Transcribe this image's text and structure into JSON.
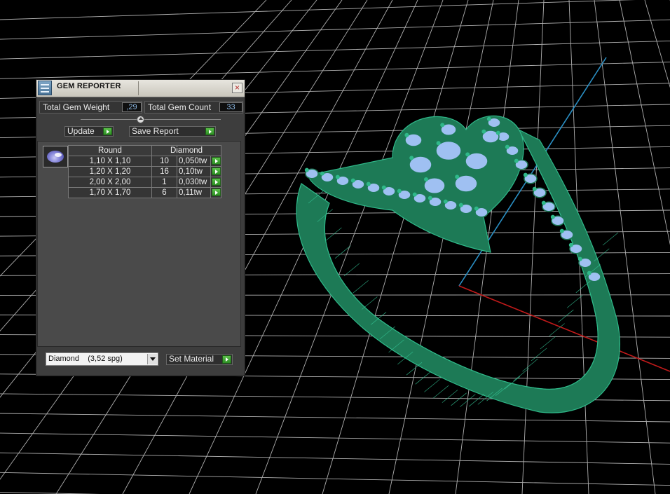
{
  "window": {
    "title": "GEM REPORTER",
    "icon": "gem-reporter-app-icon"
  },
  "summary": {
    "weight_label": "Total Gem Weight",
    "weight_value": ",29",
    "count_label": "Total Gem Count",
    "count_value": "33"
  },
  "toolbar": {
    "update_label": "Update",
    "save_report_label": "Save Report"
  },
  "gems_table": {
    "headers": [
      "Round",
      "Diamond"
    ],
    "rows": [
      {
        "size": "1,10 X 1,10",
        "count": "10",
        "weight": "0,050tw"
      },
      {
        "size": "1,20 X 1,20",
        "count": "16",
        "weight": "0,10tw"
      },
      {
        "size": "2,00 X 2,00",
        "count": "1",
        "weight": "0,030tw"
      },
      {
        "size": "1,70 X 1,70",
        "count": "6",
        "weight": "0,11tw"
      }
    ]
  },
  "material": {
    "selected": "Diamond    (3,52 spg)",
    "set_label": "Set Material"
  },
  "colors": {
    "model_green": "#1d7a56",
    "wire_green": "#2fb889",
    "stone_blue": "#9fc0f2",
    "grid": "#cfcfcf",
    "axis_red": "#c11a1a",
    "axis_blue": "#2a8fc4",
    "accent_button": "#3faa33"
  },
  "icons": [
    "gem-reporter-app-icon",
    "close-icon",
    "slider-knob-icon",
    "go-arrow-icon",
    "round-diamond-icon",
    "dropdown-arrow-icon"
  ]
}
